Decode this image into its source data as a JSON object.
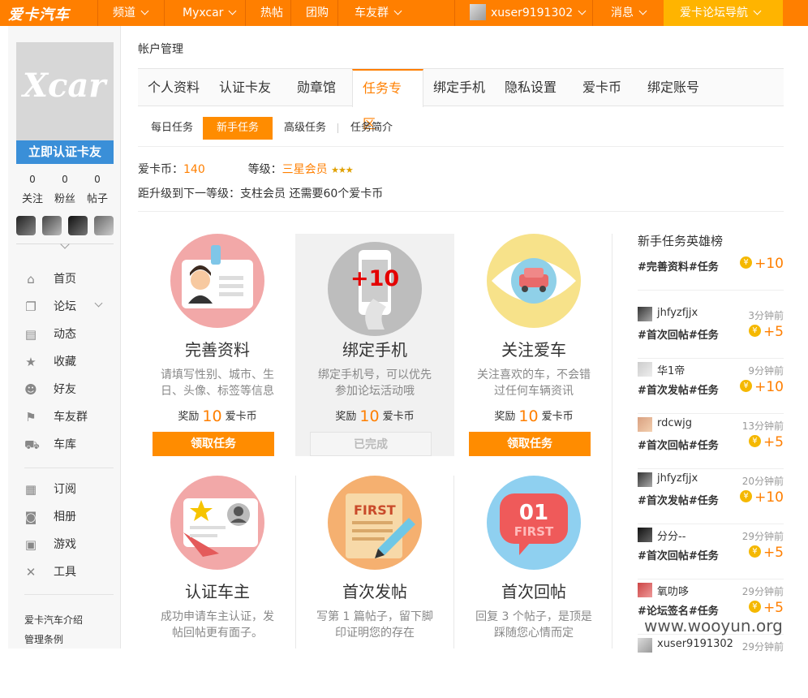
{
  "topnav": {
    "logo": "爱卡汽车",
    "items": [
      "频道",
      "Myxcar",
      "热帖",
      "团购",
      "车友群"
    ],
    "username": "xuser9191302",
    "messages": "消息",
    "guide": "爱卡论坛导航"
  },
  "sidebar": {
    "avatar_mark": "Xcar",
    "verify_badge": "立即认证卡友",
    "stats": [
      {
        "count": "0",
        "label": "关注"
      },
      {
        "count": "0",
        "label": "粉丝"
      },
      {
        "count": "0",
        "label": "帖子"
      }
    ],
    "menu": [
      {
        "label": "首页",
        "icon": "home-icon"
      },
      {
        "label": "论坛",
        "icon": "forum-icon"
      },
      {
        "label": "动态",
        "icon": "chat-icon"
      },
      {
        "label": "收藏",
        "icon": "star-icon"
      },
      {
        "label": "好友",
        "icon": "friends-icon"
      },
      {
        "label": "车友群",
        "icon": "flag-icon"
      },
      {
        "label": "车库",
        "icon": "car-icon"
      }
    ],
    "menu2": [
      {
        "label": "订阅",
        "icon": "subscribe-icon"
      },
      {
        "label": "相册",
        "icon": "camera-icon"
      },
      {
        "label": "游戏",
        "icon": "gamepad-icon"
      },
      {
        "label": "工具",
        "icon": "tools-icon"
      }
    ],
    "links": [
      "爱卡汽车介绍",
      "管理条例"
    ]
  },
  "main": {
    "breadcrumb": "帐户管理",
    "tabs": [
      "个人资料",
      "认证卡友",
      "勋章馆",
      "任务专区",
      "绑定手机",
      "隐私设置",
      "爱卡币",
      "绑定账号"
    ],
    "active_tab": "任务专区",
    "subtabs": [
      "每日任务",
      "新手任务",
      "高级任务",
      "任务简介"
    ],
    "active_subtab": "新手任务",
    "coin_label": "爱卡币：",
    "coin_value": "140",
    "level_label": "等级：",
    "level_value": "三星会员",
    "level_stars": "★★★",
    "next_level": "距升级到下一等级：支柱会员 还需要60个爱卡币"
  },
  "tasks": [
    {
      "title": "完善资料",
      "desc": "请填写性别、城市、生日、头像、标签等信息",
      "reward_prefix": "奖励",
      "reward": "10",
      "reward_unit": "爱卡币",
      "button": "领取任务",
      "done": false
    },
    {
      "title": "绑定手机",
      "desc": "绑定手机号，可以优先参加论坛活动哦",
      "reward_prefix": "奖励",
      "reward": "10",
      "reward_unit": "爱卡币",
      "button": "已完成",
      "done": true,
      "overlay": "+10"
    },
    {
      "title": "关注爱车",
      "desc": "关注喜欢的车，不会错过任何车辆资讯",
      "reward_prefix": "奖励",
      "reward": "10",
      "reward_unit": "爱卡币",
      "button": "领取任务",
      "done": false
    },
    {
      "title": "认证车主",
      "desc": "成功申请车主认证，发帖回帖更有面子。",
      "done": false
    },
    {
      "title": "首次发帖",
      "desc": "写第 1 篇帖子，留下脚印证明您的存在",
      "done": false,
      "icon_text": "FIRST"
    },
    {
      "title": "首次回帖",
      "desc": "回复 3 个帖子，是顶是踩随您心情而定",
      "done": false,
      "icon_text": "01",
      "icon_sub": "FIRST"
    }
  ],
  "rank": {
    "title": "新手任务英雄榜",
    "items": [
      {
        "name": "",
        "time": "",
        "task": "#完善资料#任务",
        "coins": "+10"
      },
      {
        "name": "jhfyzfjjx",
        "time": "3分钟前",
        "task": "#首次回帖#任务",
        "coins": "+5"
      },
      {
        "name": "华1帝",
        "time": "9分钟前",
        "task": "#首次发帖#任务",
        "coins": "+10"
      },
      {
        "name": "rdcwjg",
        "time": "13分钟前",
        "task": "#首次回帖#任务",
        "coins": "+5"
      },
      {
        "name": "jhfyzfjjx",
        "time": "20分钟前",
        "task": "#首次发帖#任务",
        "coins": "+10"
      },
      {
        "name": "分分--",
        "time": "29分钟前",
        "task": "#首次回帖#任务",
        "coins": "+5"
      },
      {
        "name": "氧叻哆",
        "time": "29分钟前",
        "task": "#论坛签名#任务",
        "coins": "+5"
      },
      {
        "name": "xuser9191302",
        "time": "29分钟前",
        "task": "",
        "coins": ""
      }
    ]
  },
  "watermark": "www.wooyun.org",
  "colors": {
    "brand": "#ff7f00",
    "guide": "#ffb400",
    "verify": "#3a8fd8"
  }
}
